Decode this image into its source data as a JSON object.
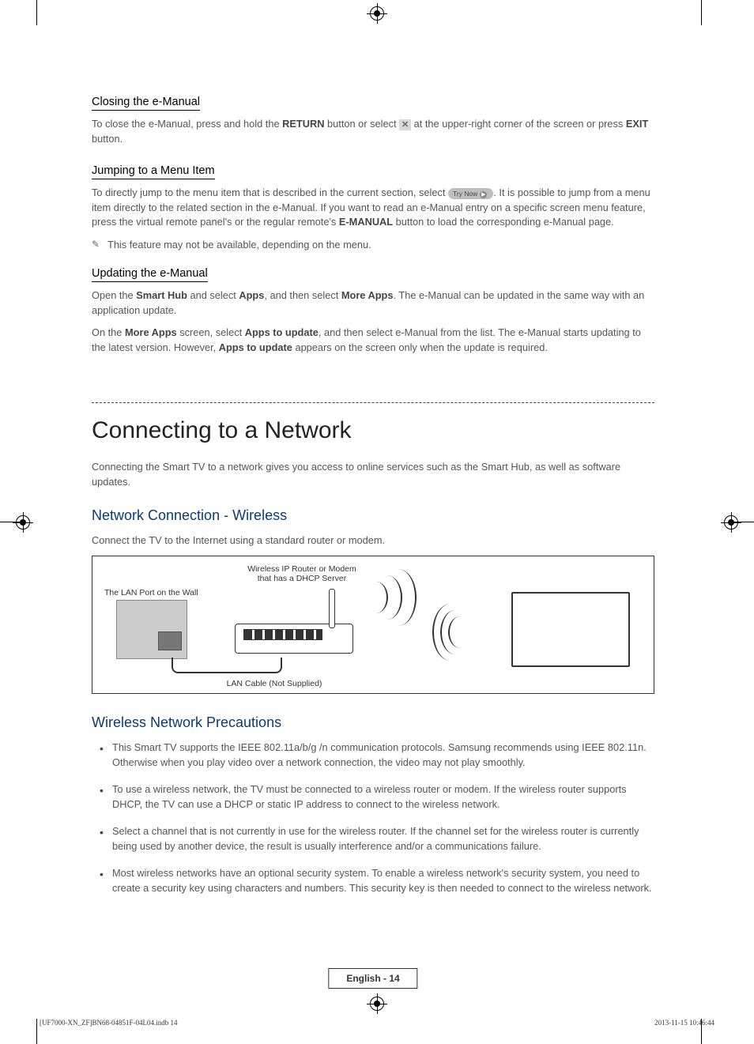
{
  "sections": {
    "closing": {
      "heading": "Closing the e-Manual",
      "para1_a": "To close the e-Manual, press and hold the ",
      "return": "RETURN",
      "para1_b": " button or select ",
      "para1_c": " at the upper-right corner of the screen or press ",
      "exit": "EXIT",
      "para1_d": " button."
    },
    "jumping": {
      "heading": "Jumping to a Menu Item",
      "para1_a": "To directly jump to the menu item that is described in the current section, select ",
      "trynow": "Try Now",
      "para1_b": ". It is possible to jump from a menu item directly to the related section in the e-Manual. If you want to read an e-Manual entry on a specific screen menu feature, press the virtual remote panel's or the regular remote's ",
      "emanual": "E-MANUAL",
      "para1_c": " button to load the corresponding e-Manual page.",
      "note": "This feature may not be available, depending on the menu."
    },
    "updating": {
      "heading": "Updating the e-Manual",
      "para1_a": "Open the ",
      "smarthub": "Smart Hub",
      "para1_b": " and select ",
      "apps": "Apps",
      "para1_c": ", and then select ",
      "moreapps": "More Apps",
      "para1_d": ". The e-Manual can be updated in the same way with an application update.",
      "para2_a": "On the ",
      "moreapps2": "More Apps",
      "para2_b": " screen, select ",
      "appstoupdate": "Apps to update",
      "para2_c": ", and then select e-Manual from the list. The e-Manual starts updating to the latest version. However, ",
      "appstoupdate2": "Apps to update",
      "para2_d": " appears on the screen only when the update is required."
    },
    "network": {
      "title": "Connecting to a Network",
      "intro": "Connecting the Smart TV to a network gives you access to online services such as the Smart Hub, as well as software updates.",
      "wireless_heading": "Network Connection - Wireless",
      "wireless_intro": "Connect the TV to the Internet using a standard router or modem.",
      "diagram": {
        "router_label_a": "Wireless IP Router or Modem",
        "router_label_b": "that has a DHCP Server",
        "wall_label": "The LAN Port on the Wall",
        "cable_label": "LAN Cable (Not Supplied)"
      },
      "precautions_heading": "Wireless Network Precautions",
      "bullets": [
        "This Smart TV supports the IEEE 802.11a/b/g /n communication protocols. Samsung recommends using IEEE 802.11n. Otherwise when you play video over a network connection, the video may not play smoothly.",
        "To use a wireless network, the TV must be connected to a wireless router or modem. If the wireless router supports DHCP, the TV can use a DHCP or static IP address to connect to the wireless network.",
        "Select a channel that is not currently in use for the wireless router. If the channel set for the wireless router is currently being used by another device, the result is usually interference and/or a communications failure.",
        "Most wireless networks have an optional security system. To enable a wireless network's security system, you need to create a security key using characters and numbers. This security key is then needed to connect to the wireless network."
      ]
    }
  },
  "footer": {
    "page_label": "English - 14",
    "doc_left": "[UF7000-XN_ZF]BN68-04851F-04L04.indb   14",
    "doc_right": "2013-11-15    10:46:44"
  }
}
